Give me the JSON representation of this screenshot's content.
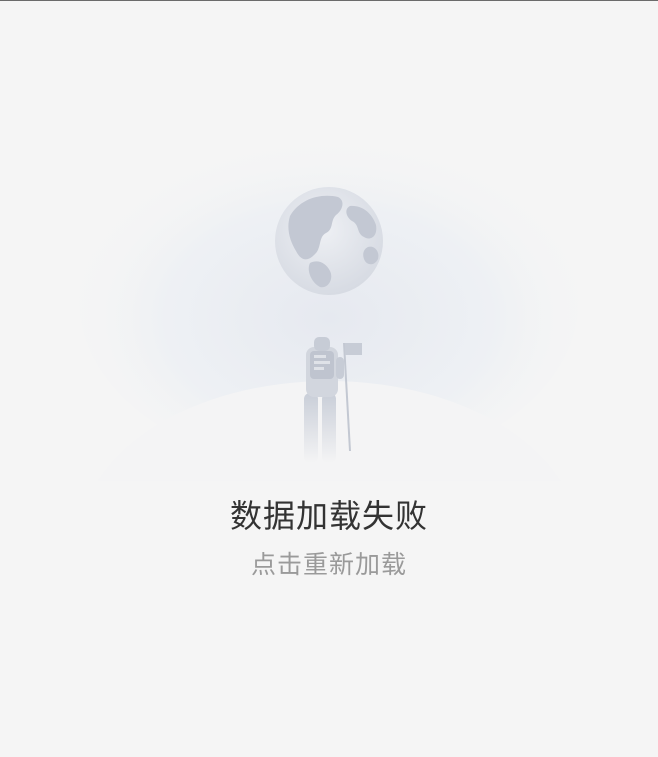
{
  "empty_state": {
    "title": "数据加载失败",
    "retry_label": "点击重新加载",
    "illustration": "astronaut-with-flag-on-moon-looking-at-earth"
  },
  "colors": {
    "background": "#f5f5f5",
    "title": "#333333",
    "retry": "#9a9a9a",
    "illustration": "#c5cad5"
  }
}
